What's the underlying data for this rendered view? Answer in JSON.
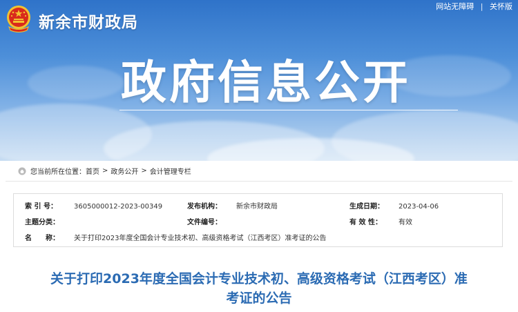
{
  "header": {
    "site_name": "新余市财政局",
    "top_links": [
      "网站无障碍",
      "关怀版"
    ],
    "banner_title": "政府信息公开"
  },
  "breadcrumb": {
    "prefix": "您当前所在位置：",
    "items": [
      "首页",
      "政务公开",
      "会计管理专栏"
    ]
  },
  "info": {
    "index_label": "索 引 号：",
    "index_value": "3605000012-2023-00349",
    "publisher_label": "发布机构：",
    "publisher_value": "新余市财政局",
    "date_label": "生成日期：",
    "date_value": "2023-04-06",
    "topic_label": "主题分类：",
    "topic_value": "",
    "docno_label": "文件编号：",
    "docno_value": "",
    "validity_label": "有 效 性：",
    "validity_value": "有效",
    "name_label": "名　　称：",
    "name_value": "关于打印2023年度全国会计专业技术初、高级资格考试（江西考区）准考证的公告"
  },
  "article": {
    "title_line1": "关于打印2023年度全国会计专业技术初、高级资格考试（江西考区）准",
    "title_line2": "考证的公告"
  },
  "colors": {
    "title_blue": "#2b6bb3",
    "banner_top": "#2f73c9",
    "emblem_red": "#d92a1c",
    "emblem_gold": "#f2c230"
  }
}
